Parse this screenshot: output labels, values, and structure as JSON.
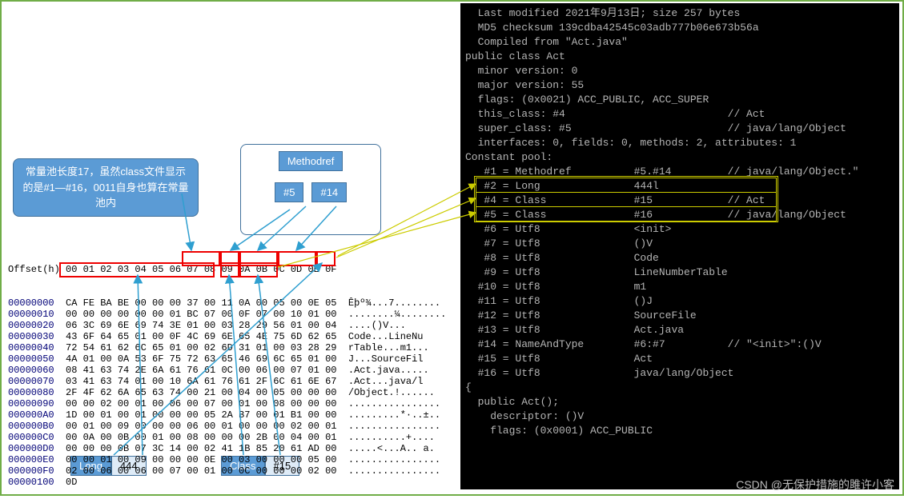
{
  "callout_text": "常量池长度17，虽然class文件显示的是#1—#16，0011自身也算在常量池内",
  "tags": {
    "methodref": "Methodref",
    "m5": "#5",
    "m14": "#14",
    "long": "Long",
    "long_val": "444",
    "class": "Class",
    "c15": "#15"
  },
  "hex": {
    "header": "Offset(h) 00 01 02 03 04 05 06 07 08 09 0A 0B 0C 0D 0E 0F",
    "rows": [
      {
        "off": "00000000",
        "hex": "CA FE BA BE 00 00 00 37 00 11 0A 00 05 00 0E 05",
        "asc": "Êþº¾...7........"
      },
      {
        "off": "00000010",
        "hex": "00 00 00 00 00 00 01 BC 07 00 0F 07 00 10 01 00",
        "asc": "........¼........"
      },
      {
        "off": "00000020",
        "hex": "06 3C 69 6E 69 74 3E 01 00 03 28 29 56 01 00 04",
        "asc": ".<init>...()V..."
      },
      {
        "off": "00000030",
        "hex": "43 6F 64 65 01 00 0F 4C 69 6E 65 4E 75 6D 62 65",
        "asc": "Code...LineNu"
      },
      {
        "off": "00000040",
        "hex": "72 54 61 62 6C 65 01 00 02 6D 31 01 00 03 28 29",
        "asc": "rTable...m1..."
      },
      {
        "off": "00000050",
        "hex": "4A 01 00 0A 53 6F 75 72 63 65 46 69 6C 65 01 00",
        "asc": "J...SourceFil"
      },
      {
        "off": "00000060",
        "hex": "08 41 63 74 2E 6A 61 76 61 0C 00 06 00 07 01 00",
        "asc": ".Act.java....."
      },
      {
        "off": "00000070",
        "hex": "03 41 63 74 01 00 10 6A 61 76 61 2F 6C 61 6E 67",
        "asc": ".Act...java/l"
      },
      {
        "off": "00000080",
        "hex": "2F 4F 62 6A 65 63 74 00 21 00 04 00 05 00 00 00",
        "asc": "/Object.!......"
      },
      {
        "off": "00000090",
        "hex": "00 00 02 00 01 00 06 00 07 00 01 00 08 00 00 00",
        "asc": "................"
      },
      {
        "off": "000000A0",
        "hex": "1D 00 01 00 01 00 00 00 05 2A B7 00 01 B1 00 00",
        "asc": ".........*·..±.."
      },
      {
        "off": "000000B0",
        "hex": "00 01 00 09 00 00 00 06 00 01 00 00 00 02 00 01",
        "asc": "................"
      },
      {
        "off": "000000C0",
        "hex": "00 0A 00 0B 00 01 00 08 00 00 00 2B 00 04 00 01",
        "asc": "..........+...."
      },
      {
        "off": "000000D0",
        "hex": "00 00 00 0B 07 3C 14 00 02 41 1B 85 20 61 AD 00",
        "asc": ".....<...A.. a­."
      },
      {
        "off": "000000E0",
        "hex": "00 00 01 00 09 00 00 00 0E 00 03 00 00 00 05 00",
        "asc": "................"
      },
      {
        "off": "000000F0",
        "hex": "02 00 06 00 06 00 07 00 01 00 0C 00 00 00 02 00",
        "asc": "................"
      },
      {
        "off": "00000100",
        "hex": "0D",
        "asc": ""
      }
    ]
  },
  "term": {
    "lines": [
      "  Last modified 2021年9月13日; size 257 bytes",
      "  MD5 checksum 139cdba42545c03adb777b06e673b56a",
      "  Compiled from \"Act.java\"",
      "public class Act",
      "  minor version: 0",
      "  major version: 55",
      "  flags: (0x0021) ACC_PUBLIC, ACC_SUPER",
      "  this_class: #4                          // Act",
      "  super_class: #5                         // java/lang/Object",
      "  interfaces: 0, fields: 0, methods: 2, attributes: 1",
      "Constant pool:",
      "   #1 = Methodref          #5.#14         // java/lang/Object.\"",
      "   #2 = Long               444l",
      "   #4 = Class              #15            // Act",
      "   #5 = Class              #16            // java/lang/Object",
      "   #6 = Utf8               <init>",
      "   #7 = Utf8               ()V",
      "   #8 = Utf8               Code",
      "   #9 = Utf8               LineNumberTable",
      "  #10 = Utf8               m1",
      "  #11 = Utf8               ()J",
      "  #12 = Utf8               SourceFile",
      "  #13 = Utf8               Act.java",
      "  #14 = NameAndType        #6:#7          // \"<init>\":()V",
      "  #15 = Utf8               Act",
      "  #16 = Utf8               java/lang/Object",
      "{",
      "  public Act();",
      "    descriptor: ()V",
      "    flags: (0x0001) ACC_PUBLIC"
    ]
  },
  "watermark": "CSDN @无保护措施的雎许小客"
}
